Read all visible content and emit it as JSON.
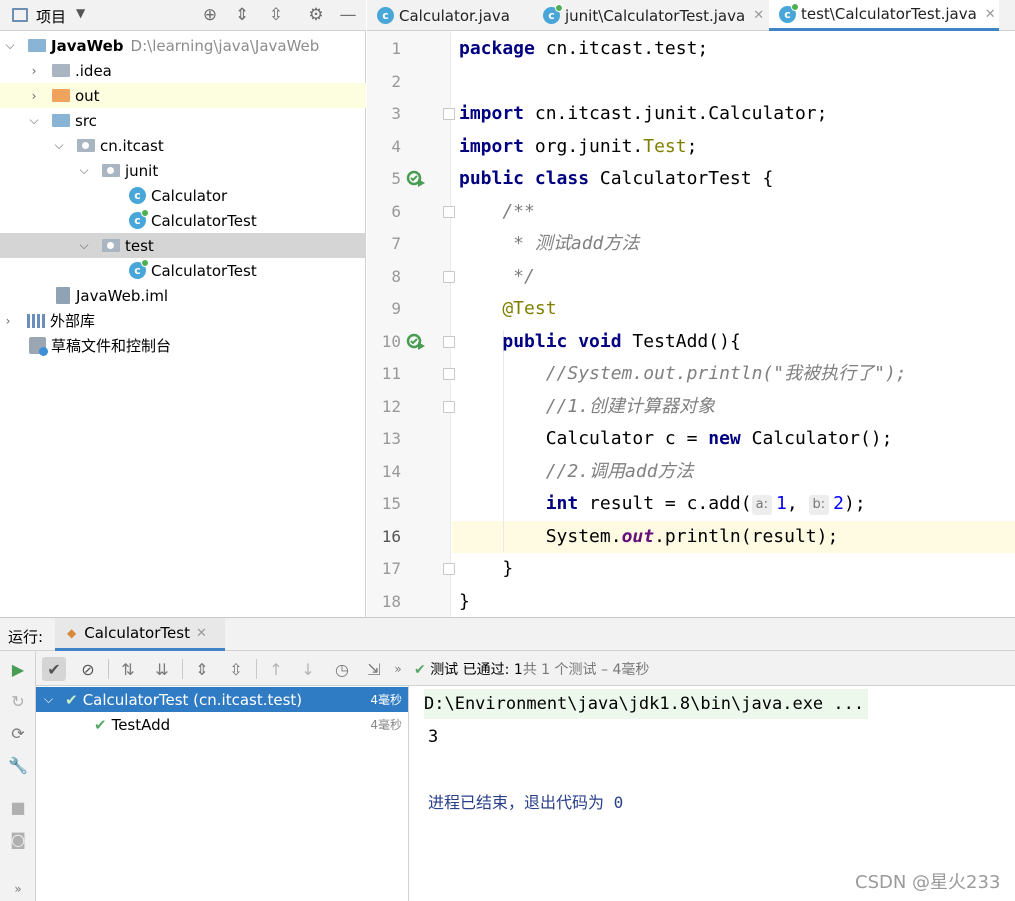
{
  "project_panel": {
    "title": "项目",
    "tree": [
      {
        "label": "JavaWeb",
        "path": "D:\\learning\\java\\JavaWeb"
      },
      {
        "label": ".idea"
      },
      {
        "label": "out"
      },
      {
        "label": "src"
      },
      {
        "label": "cn.itcast"
      },
      {
        "label": "junit"
      },
      {
        "label": "Calculator"
      },
      {
        "label": "CalculatorTest"
      },
      {
        "label": "test"
      },
      {
        "label": "CalculatorTest"
      },
      {
        "label": "JavaWeb.iml"
      },
      {
        "label": "外部库"
      },
      {
        "label": "草稿文件和控制台"
      }
    ]
  },
  "editor": {
    "tabs": [
      {
        "label": "Calculator.java"
      },
      {
        "label": "junit\\CalculatorTest.java"
      },
      {
        "label": "test\\CalculatorTest.java"
      }
    ],
    "line_numbers": [
      "1",
      "2",
      "3",
      "4",
      "5",
      "6",
      "7",
      "8",
      "9",
      "10",
      "11",
      "12",
      "13",
      "14",
      "15",
      "16",
      "17",
      "18"
    ],
    "code": {
      "l1_kw": "package",
      "l1_rest": " cn.itcast.test;",
      "l3_kw": "import",
      "l3_rest": " cn.itcast.junit.Calculator;",
      "l4_kw": "import",
      "l4_rest": " org.junit.",
      "l4_ann": "Test",
      "l4_end": ";",
      "l5_kw": "public class",
      "l5_rest": " CalculatorTest {",
      "l6": "    /**",
      "l7": "     * 测试add方法",
      "l8": "     */",
      "l9": "    @Test",
      "l10_ind": "    ",
      "l10_kw": "public void",
      "l10_rest": " TestAdd(){",
      "l11": "        //System.out.println(\"我被执行了\");",
      "l12": "        //1.创建计算器对象",
      "l13_a": "        Calculator c = ",
      "l13_kw": "new",
      "l13_b": " Calculator();",
      "l14": "        //2.调用add方法",
      "l15_ind": "        ",
      "l15_kw": "int",
      "l15_a": " result = c.add(",
      "l15_hint_a": "a:",
      "l15_n1": "1",
      "l15_comma": ", ",
      "l15_hint_b": "b:",
      "l15_n2": "2",
      "l15_end": ");",
      "l16_a": "        System.",
      "l16_fld": "out",
      "l16_b": ".println(result);",
      "l17": "    }",
      "l18": "}"
    }
  },
  "run_panel": {
    "label": "运行:",
    "tab": "CalculatorTest",
    "status_prefix": "测试 已通过: ",
    "status_count": "1",
    "status_suffix": "共 1 个测试 – 4毫秒",
    "tree": [
      {
        "label": "CalculatorTest (cn.itcast.test)",
        "time": "4毫秒"
      },
      {
        "label": "TestAdd",
        "time": "4毫秒"
      }
    ],
    "console": {
      "command": "D:\\Environment\\java\\jdk1.8\\bin\\java.exe ...",
      "output": "3",
      "exit": "进程已结束，退出代码为 0"
    }
  },
  "watermark": "CSDN @星火233",
  "colors": {
    "accent": "#4083c9",
    "selection": "#2f7bc4",
    "pass": "#59a869"
  }
}
